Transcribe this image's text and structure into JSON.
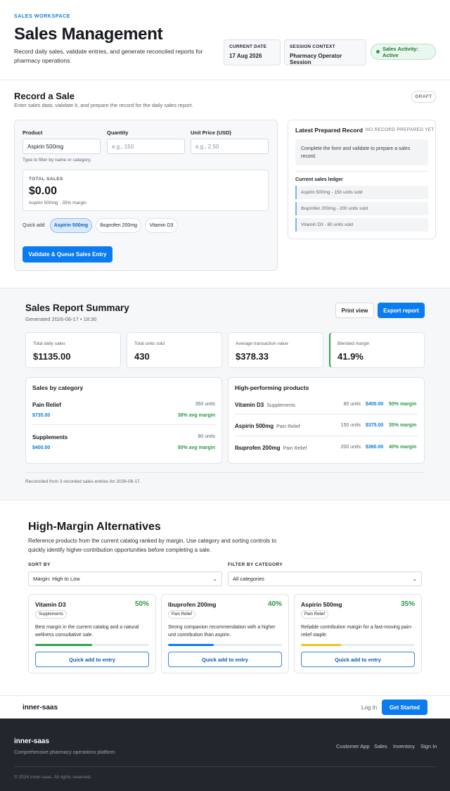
{
  "header": {
    "eyebrow": "SALES WORKSPACE",
    "title": "Sales Management",
    "description": "Record daily sales, validate entries, and generate reconciled reports for pharmacy operations.",
    "current_date_label": "CURRENT DATE",
    "current_date_value": "17 Aug 2026",
    "session_label": "SESSION CONTEXT",
    "session_value": "Pharmacy Operator Session",
    "status": "Sales Activity: Active"
  },
  "record": {
    "title": "Record a Sale",
    "subtitle": "Enter sales data, validate it, and prepare the record for the daily sales report.",
    "badge": "DRAFT",
    "product_label": "Product",
    "product_value": "Aspirin 500mg",
    "product_hint": "Type to filter by name or category.",
    "quantity_label": "Quantity",
    "quantity_placeholder": "e.g., 150",
    "price_label": "Unit Price (USD)",
    "price_placeholder": "e.g., 2.50",
    "total_label": "TOTAL SALES",
    "total_value": "$0.00",
    "total_sub": "Aspirin 500mg · 35% margin",
    "quick_add_label": "Quick add",
    "quick_add": [
      "Aspirin 500mg",
      "Ibuprofen 200mg",
      "Vitamin D3"
    ],
    "submit_label": "Validate & Queue Sales Entry"
  },
  "latest": {
    "title": "Latest Prepared Record",
    "status": "NO RECORD PREPARED YET",
    "message": "Complete the form and validate to prepare a sales record.",
    "ledger_title": "Current sales ledger",
    "ledger": [
      "Aspirin 500mg - 150 units sold",
      "Ibuprofen 200mg - 200 units sold",
      "Vitamin D3 - 80 units sold"
    ]
  },
  "report": {
    "title": "Sales Report Summary",
    "generated": "Generated 2026-08-17 • 18:30",
    "print_label": "Print view",
    "export_label": "Export report",
    "stats": [
      {
        "label": "Total daily sales",
        "value": "$1135.00"
      },
      {
        "label": "Total units sold",
        "value": "430"
      },
      {
        "label": "Average transaction value",
        "value": "$378.33"
      },
      {
        "label": "Blended margin",
        "value": "41.9%"
      }
    ],
    "category_title": "Sales by category",
    "categories": [
      {
        "name": "Pain Relief",
        "units": "350 units",
        "amount": "$735.00",
        "margin": "38% avg margin"
      },
      {
        "name": "Supplements",
        "units": "80 units",
        "amount": "$400.00",
        "margin": "50% avg margin"
      }
    ],
    "products_title": "High-performing products",
    "products": [
      {
        "name": "Vitamin D3",
        "category": "Supplements",
        "units": "80 units",
        "amount": "$400.00",
        "margin": "50% margin"
      },
      {
        "name": "Aspirin 500mg",
        "category": "Pain Relief",
        "units": "150 units",
        "amount": "$375.00",
        "margin": "35% margin"
      },
      {
        "name": "Ibuprofen 200mg",
        "category": "Pain Relief",
        "units": "200 units",
        "amount": "$360.00",
        "margin": "40% margin"
      }
    ],
    "reconciled": "Reconciled from 3 recorded sales entries for 2026-08-17."
  },
  "alternatives": {
    "title": "High-Margin Alternatives",
    "description": "Reference products from the current catalog ranked by margin. Use category and sorting controls to quickly identify higher-contribution opportunities before completing a sale.",
    "sort_label": "SORT BY",
    "sort_value": "Margin: High to Low",
    "filter_label": "FILTER BY CATEGORY",
    "filter_value": "All categories",
    "cards": [
      {
        "name": "Vitamin D3",
        "margin": "50%",
        "margin_fraction": 0.5,
        "tag": "Supplements",
        "desc": "Best margin in the current catalog and a natural wellness consultative sale.",
        "bar_color": "#2fa24a",
        "button": "Quick add to entry"
      },
      {
        "name": "Ibuprofen 200mg",
        "margin": "40%",
        "margin_fraction": 0.4,
        "tag": "Pain Relief",
        "desc": "Strong companion recommendation with a higher unit contribution than aspirin.",
        "bar_color": "#0b7bf0",
        "button": "Quick add to entry"
      },
      {
        "name": "Aspirin 500mg",
        "margin": "35%",
        "margin_fraction": 0.35,
        "tag": "Pain Relief",
        "desc": "Reliable contribution margin for a fast-moving pain-relief staple.",
        "bar_color": "#f2c21b",
        "button": "Quick add to entry"
      }
    ]
  },
  "nav": {
    "brand": "inner-saas",
    "login": "Log In",
    "cta": "Get Started"
  },
  "footer": {
    "brand": "inner-saas",
    "tagline": "Comprehensive pharmacy operations platform",
    "links": [
      "Customer App",
      "Sales",
      "Inventory",
      "Sign In"
    ],
    "copyright": "© 2024 inner-saas. All rights reserved."
  },
  "colors": {
    "accent": "#0b7bf0",
    "success": "#2fa24a",
    "footer_bg": "#22272d"
  }
}
